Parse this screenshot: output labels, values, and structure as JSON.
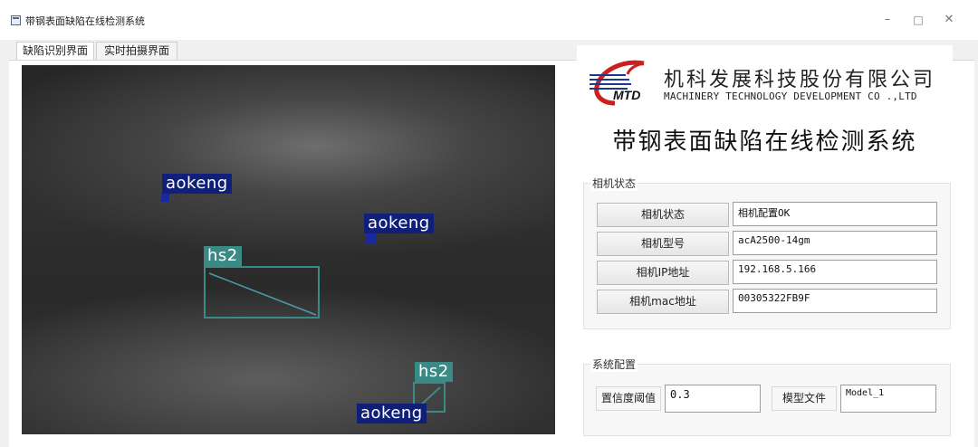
{
  "window": {
    "title": "带钢表面缺陷在线检测系统",
    "minimize": "–",
    "maximize": "□",
    "close": "✕"
  },
  "tabs": [
    {
      "label": "缺陷识别界面",
      "active": true
    },
    {
      "label": "实时拍摄界面",
      "active": false
    }
  ],
  "detections": [
    {
      "label": "aokeng"
    },
    {
      "label": "aokeng"
    },
    {
      "label": "hs2"
    },
    {
      "label": "hs2"
    },
    {
      "label": "aokeng"
    }
  ],
  "logo": {
    "mark": "MTD",
    "company_cn": "机科发展科技股份有限公司",
    "company_en": "MACHINERY TECHNOLOGY DEVELOPMENT CO .,LTD"
  },
  "system_title": "带钢表面缺陷在线检测系统",
  "camera_group": {
    "title": "相机状态",
    "rows": [
      {
        "button": "相机状态",
        "value": "相机配置OK"
      },
      {
        "button": "相机型号",
        "value": "acA2500-14gm"
      },
      {
        "button": "相机IP地址",
        "value": "192.168.5.166"
      },
      {
        "button": "相机mac地址",
        "value": "00305322FB9F"
      }
    ]
  },
  "system_group": {
    "title": "系统配置",
    "threshold_button": "置信度阈值",
    "threshold_value": "0.3",
    "model_button": "模型文件",
    "model_value": "Model_1"
  },
  "colors": {
    "aokeng_label_bg": "#0f1f7a",
    "hs2_label_bg": "#3a8a86",
    "logo_red": "#cc1f1f",
    "logo_blue": "#1b3a8c"
  }
}
